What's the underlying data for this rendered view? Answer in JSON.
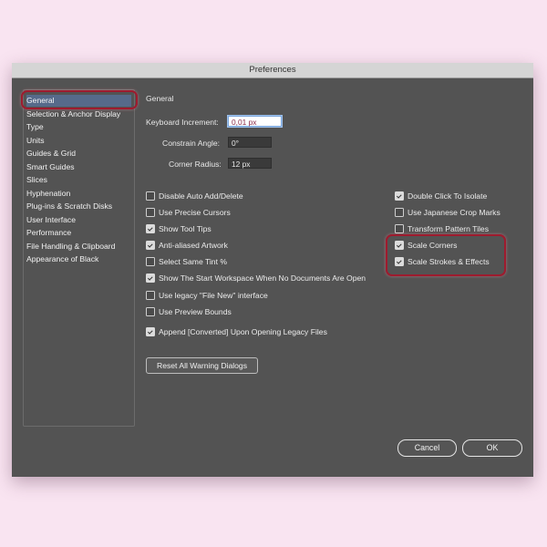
{
  "window": {
    "title": "Preferences"
  },
  "sidebar": {
    "items": [
      {
        "label": "General",
        "selected": true
      },
      {
        "label": "Selection & Anchor Display"
      },
      {
        "label": "Type"
      },
      {
        "label": "Units"
      },
      {
        "label": "Guides & Grid"
      },
      {
        "label": "Smart Guides"
      },
      {
        "label": "Slices"
      },
      {
        "label": "Hyphenation"
      },
      {
        "label": "Plug-ins & Scratch Disks"
      },
      {
        "label": "User Interface"
      },
      {
        "label": "Performance"
      },
      {
        "label": "File Handling & Clipboard"
      },
      {
        "label": "Appearance of Black"
      }
    ]
  },
  "panel": {
    "heading": "General",
    "keyboard_increment": {
      "label": "Keyboard Increment:",
      "value": "0,01 px"
    },
    "constrain_angle": {
      "label": "Constrain Angle:",
      "value": "0°"
    },
    "corner_radius": {
      "label": "Corner Radius:",
      "value": "12 px"
    }
  },
  "options_left": [
    {
      "label": "Disable Auto Add/Delete",
      "checked": false
    },
    {
      "label": "Use Precise Cursors",
      "checked": false
    },
    {
      "label": "Show Tool Tips",
      "checked": true
    },
    {
      "label": "Anti-aliased Artwork",
      "checked": true
    },
    {
      "label": "Select Same Tint %",
      "checked": false
    },
    {
      "label": "Show The Start Workspace When No Documents Are Open",
      "checked": true
    },
    {
      "label": "Use legacy \"File New\" interface",
      "checked": false
    },
    {
      "label": "Use Preview Bounds",
      "checked": false
    },
    {
      "label": "Append [Converted] Upon Opening Legacy Files",
      "checked": true
    }
  ],
  "options_right": [
    {
      "label": "Double Click To Isolate",
      "checked": true
    },
    {
      "label": "Use Japanese Crop Marks",
      "checked": false
    },
    {
      "label": "Transform Pattern Tiles",
      "checked": false
    },
    {
      "label": "Scale Corners",
      "checked": true
    },
    {
      "label": "Scale Strokes & Effects",
      "checked": true
    }
  ],
  "buttons": {
    "reset_warnings": "Reset All Warning Dialogs",
    "cancel": "Cancel",
    "ok": "OK"
  },
  "colors": {
    "window_bg": "#535353",
    "selection": "#566a8a",
    "highlight_ring": "#9e1b2e",
    "page_bg": "#f9e4f1"
  }
}
